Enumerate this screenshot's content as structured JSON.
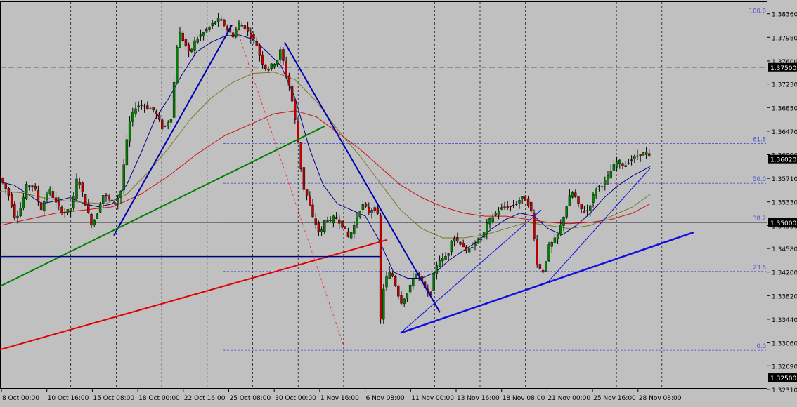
{
  "chart_data": {
    "type": "candlestick",
    "title": "",
    "ylim": [
      1.3232,
      1.3856
    ],
    "y_ticks": [
      "1.38360",
      "1.37980",
      "1.37600",
      "1.37230",
      "1.36850",
      "1.36470",
      "1.36090",
      "1.35710",
      "1.35330",
      "1.34950",
      "1.34580",
      "1.34200",
      "1.33820",
      "1.33440",
      "1.33060",
      "1.32690",
      "1.32310"
    ],
    "x_ticks": [
      "8 Oct 00:00",
      "10 Oct 16:00",
      "15 Oct 08:00",
      "18 Oct 00:00",
      "22 Oct 16:00",
      "25 Oct 08:00",
      "30 Oct 00:00",
      "1 Nov 16:00",
      "6 Nov 08:00",
      "11 Nov 00:00",
      "13 Nov 16:00",
      "18 Nov 08:00",
      "21 Nov 00:00",
      "25 Nov 16:00",
      "28 Nov 08:00"
    ],
    "price_labels": [
      {
        "value": 1.375,
        "text": "1.37500",
        "line_color": "#000000",
        "style": "dashed"
      },
      {
        "value": 1.35,
        "text": "1.35000",
        "line_color": "#000000",
        "style": "solid"
      },
      {
        "value": 1.325,
        "text": "1.32500",
        "line_color": "#000000",
        "style": "none"
      },
      {
        "value": 1.3602,
        "text": "1.36020",
        "line_color": "#000000",
        "style": "none"
      }
    ],
    "fibonacci": {
      "color": "#5050d0",
      "levels": [
        {
          "label": "100.0",
          "value": 1.3834
        },
        {
          "label": "61.8",
          "value": 1.3627
        },
        {
          "label": "50.0",
          "value": 1.3563
        },
        {
          "label": "38.2",
          "value": 1.35
        },
        {
          "label": "23.6",
          "value": 1.3421
        },
        {
          "label": "0.0",
          "value": 1.3294
        }
      ]
    },
    "candle_colors": {
      "up": "#008000",
      "down": "#c00000",
      "wick": "#000000"
    },
    "candle_anchors": [
      [
        0,
        1.3575
      ],
      [
        8,
        1.356
      ],
      [
        16,
        1.354
      ],
      [
        24,
        1.3505
      ],
      [
        32,
        1.3525
      ],
      [
        40,
        1.356
      ],
      [
        50,
        1.356
      ],
      [
        60,
        1.352
      ],
      [
        72,
        1.3555
      ],
      [
        82,
        1.353
      ],
      [
        92,
        1.3515
      ],
      [
        102,
        1.352
      ],
      [
        108,
        1.3545
      ],
      [
        112,
        1.3575
      ],
      [
        120,
        1.3545
      ],
      [
        126,
        1.352
      ],
      [
        133,
        1.3495
      ],
      [
        142,
        1.352
      ],
      [
        148,
        1.3545
      ],
      [
        160,
        1.3535
      ],
      [
        166,
        1.353
      ],
      [
        174,
        1.355
      ],
      [
        180,
        1.361
      ],
      [
        186,
        1.366
      ],
      [
        194,
        1.3685
      ],
      [
        202,
        1.369
      ],
      [
        212,
        1.3685
      ],
      [
        222,
        1.368
      ],
      [
        234,
        1.365
      ],
      [
        246,
        1.367
      ],
      [
        252,
        1.376
      ],
      [
        256,
        1.381
      ],
      [
        264,
        1.379
      ],
      [
        272,
        1.377
      ],
      [
        278,
        1.379
      ],
      [
        286,
        1.38
      ],
      [
        296,
        1.381
      ],
      [
        303,
        1.3818
      ],
      [
        312,
        1.3828
      ],
      [
        320,
        1.382
      ],
      [
        326,
        1.381
      ],
      [
        334,
        1.38
      ],
      [
        342,
        1.382
      ],
      [
        350,
        1.3815
      ],
      [
        356,
        1.3805
      ],
      [
        366,
        1.379
      ],
      [
        374,
        1.376
      ],
      [
        382,
        1.3745
      ],
      [
        390,
        1.3755
      ],
      [
        396,
        1.376
      ],
      [
        402,
        1.378
      ],
      [
        408,
        1.374
      ],
      [
        414,
        1.372
      ],
      [
        420,
        1.368
      ],
      [
        426,
        1.363
      ],
      [
        430,
        1.359
      ],
      [
        434,
        1.3555
      ],
      [
        440,
        1.354
      ],
      [
        446,
        1.351
      ],
      [
        452,
        1.3495
      ],
      [
        458,
        1.348
      ],
      [
        466,
        1.351
      ],
      [
        472,
        1.35
      ],
      [
        478,
        1.351
      ],
      [
        486,
        1.35
      ],
      [
        492,
        1.349
      ],
      [
        498,
        1.3475
      ],
      [
        506,
        1.3495
      ],
      [
        514,
        1.352
      ],
      [
        520,
        1.353
      ],
      [
        526,
        1.3515
      ],
      [
        534,
        1.3525
      ],
      [
        540,
        1.351
      ],
      [
        543,
        1.3335
      ],
      [
        548,
        1.3395
      ],
      [
        554,
        1.342
      ],
      [
        560,
        1.3415
      ],
      [
        566,
        1.3395
      ],
      [
        572,
        1.337
      ],
      [
        578,
        1.338
      ],
      [
        584,
        1.339
      ],
      [
        592,
        1.342
      ],
      [
        600,
        1.341
      ],
      [
        608,
        1.339
      ],
      [
        614,
        1.338
      ],
      [
        620,
        1.342
      ],
      [
        626,
        1.344
      ],
      [
        632,
        1.344
      ],
      [
        640,
        1.345
      ],
      [
        646,
        1.348
      ],
      [
        652,
        1.347
      ],
      [
        660,
        1.3465
      ],
      [
        666,
        1.345
      ],
      [
        672,
        1.346
      ],
      [
        680,
        1.347
      ],
      [
        688,
        1.3475
      ],
      [
        696,
        1.35
      ],
      [
        704,
        1.351
      ],
      [
        712,
        1.352
      ],
      [
        720,
        1.3525
      ],
      [
        728,
        1.3525
      ],
      [
        736,
        1.353
      ],
      [
        744,
        1.354
      ],
      [
        752,
        1.3535
      ],
      [
        760,
        1.351
      ],
      [
        764,
        1.344
      ],
      [
        770,
        1.3425
      ],
      [
        776,
        1.342
      ],
      [
        782,
        1.346
      ],
      [
        790,
        1.347
      ],
      [
        796,
        1.348
      ],
      [
        804,
        1.351
      ],
      [
        812,
        1.354
      ],
      [
        818,
        1.355
      ],
      [
        824,
        1.353
      ],
      [
        830,
        1.352
      ],
      [
        836,
        1.3515
      ],
      [
        842,
        1.353
      ],
      [
        850,
        1.3555
      ],
      [
        858,
        1.356
      ],
      [
        866,
        1.357
      ],
      [
        874,
        1.359
      ],
      [
        882,
        1.36
      ],
      [
        890,
        1.359
      ],
      [
        898,
        1.36
      ],
      [
        906,
        1.3605
      ],
      [
        914,
        1.361
      ],
      [
        922,
        1.3612
      ],
      [
        928,
        1.3602
      ]
    ],
    "moving_averages": [
      {
        "color": "#00008b",
        "points": [
          [
            0,
            1.3565
          ],
          [
            20,
            1.356
          ],
          [
            40,
            1.3545
          ],
          [
            60,
            1.353
          ],
          [
            80,
            1.3535
          ],
          [
            100,
            1.354
          ],
          [
            120,
            1.353
          ],
          [
            140,
            1.3525
          ],
          [
            160,
            1.353
          ],
          [
            180,
            1.356
          ],
          [
            200,
            1.361
          ],
          [
            220,
            1.3665
          ],
          [
            240,
            1.37
          ],
          [
            260,
            1.374
          ],
          [
            280,
            1.3775
          ],
          [
            300,
            1.379
          ],
          [
            320,
            1.38
          ],
          [
            340,
            1.3802
          ],
          [
            360,
            1.3795
          ],
          [
            380,
            1.3775
          ],
          [
            400,
            1.3752
          ],
          [
            420,
            1.37
          ],
          [
            440,
            1.362
          ],
          [
            460,
            1.356
          ],
          [
            480,
            1.353
          ],
          [
            500,
            1.352
          ],
          [
            520,
            1.351
          ],
          [
            540,
            1.347
          ],
          [
            560,
            1.342
          ],
          [
            580,
            1.341
          ],
          [
            600,
            1.341
          ],
          [
            620,
            1.342
          ],
          [
            640,
            1.344
          ],
          [
            660,
            1.3455
          ],
          [
            680,
            1.347
          ],
          [
            700,
            1.349
          ],
          [
            720,
            1.3505
          ],
          [
            740,
            1.3515
          ],
          [
            760,
            1.351
          ],
          [
            780,
            1.349
          ],
          [
            800,
            1.348
          ],
          [
            820,
            1.3495
          ],
          [
            840,
            1.3515
          ],
          [
            860,
            1.354
          ],
          [
            880,
            1.356
          ],
          [
            900,
            1.3575
          ],
          [
            925,
            1.359
          ]
        ]
      },
      {
        "color": "#7a7a20",
        "points": [
          [
            0,
            1.355
          ],
          [
            30,
            1.3548
          ],
          [
            60,
            1.354
          ],
          [
            90,
            1.3535
          ],
          [
            120,
            1.3532
          ],
          [
            150,
            1.353
          ],
          [
            180,
            1.3545
          ],
          [
            210,
            1.358
          ],
          [
            240,
            1.362
          ],
          [
            270,
            1.3665
          ],
          [
            300,
            1.37
          ],
          [
            330,
            1.3725
          ],
          [
            360,
            1.374
          ],
          [
            390,
            1.3742
          ],
          [
            420,
            1.373
          ],
          [
            450,
            1.3695
          ],
          [
            480,
            1.365
          ],
          [
            510,
            1.361
          ],
          [
            540,
            1.3565
          ],
          [
            570,
            1.352
          ],
          [
            600,
            1.349
          ],
          [
            630,
            1.3475
          ],
          [
            660,
            1.3475
          ],
          [
            690,
            1.348
          ],
          [
            720,
            1.349
          ],
          [
            750,
            1.35
          ],
          [
            780,
            1.3495
          ],
          [
            810,
            1.349
          ],
          [
            840,
            1.3495
          ],
          [
            870,
            1.351
          ],
          [
            900,
            1.3525
          ],
          [
            925,
            1.3545
          ]
        ]
      },
      {
        "color": "#d01010",
        "points": [
          [
            0,
            1.3495
          ],
          [
            40,
            1.3505
          ],
          [
            80,
            1.3515
          ],
          [
            120,
            1.352
          ],
          [
            160,
            1.3525
          ],
          [
            200,
            1.3545
          ],
          [
            240,
            1.3575
          ],
          [
            280,
            1.361
          ],
          [
            320,
            1.364
          ],
          [
            360,
            1.366
          ],
          [
            390,
            1.3675
          ],
          [
            420,
            1.368
          ],
          [
            450,
            1.367
          ],
          [
            480,
            1.3645
          ],
          [
            510,
            1.362
          ],
          [
            540,
            1.359
          ],
          [
            570,
            1.356
          ],
          [
            600,
            1.354
          ],
          [
            630,
            1.3525
          ],
          [
            660,
            1.3515
          ],
          [
            690,
            1.351
          ],
          [
            720,
            1.351
          ],
          [
            750,
            1.3505
          ],
          [
            780,
            1.35
          ],
          [
            810,
            1.3498
          ],
          [
            840,
            1.35
          ],
          [
            870,
            1.3505
          ],
          [
            900,
            1.3515
          ],
          [
            925,
            1.353
          ]
        ]
      }
    ],
    "trendlines": [
      {
        "color": "#0000b0",
        "width": 2,
        "from": [
          162,
          1.3479
        ],
        "to": [
          330,
          1.3818
        ]
      },
      {
        "color": "#0000b0",
        "width": 2,
        "from": [
          405,
          1.379
        ],
        "to": [
          626,
          1.3355
        ]
      },
      {
        "color": "#1010e0",
        "width": 2.5,
        "from": [
          570,
          1.3322
        ],
        "to": [
          987,
          1.3484
        ]
      },
      {
        "color": "#1010e0",
        "width": 1,
        "from": [
          570,
          1.3322
        ],
        "to": [
          770,
          1.352
        ]
      },
      {
        "color": "#1010e0",
        "width": 1,
        "from": [
          778,
          1.3402
        ],
        "to": [
          925,
          1.3587
        ]
      },
      {
        "color": "#008000",
        "width": 2,
        "from": [
          0,
          1.3397
        ],
        "to": [
          462,
          1.3655
        ]
      },
      {
        "color": "#e00000",
        "width": 2,
        "from": [
          0,
          1.3295
        ],
        "to": [
          551,
          1.3472
        ]
      },
      {
        "color": "#000080",
        "width": 1.5,
        "from": [
          0,
          1.3445
        ],
        "to": [
          542,
          1.3445
        ]
      },
      {
        "color": "#ff3030",
        "width": 1,
        "dash": true,
        "from": [
          336,
          1.3815
        ],
        "to": [
          489,
          1.3301
        ]
      }
    ]
  }
}
